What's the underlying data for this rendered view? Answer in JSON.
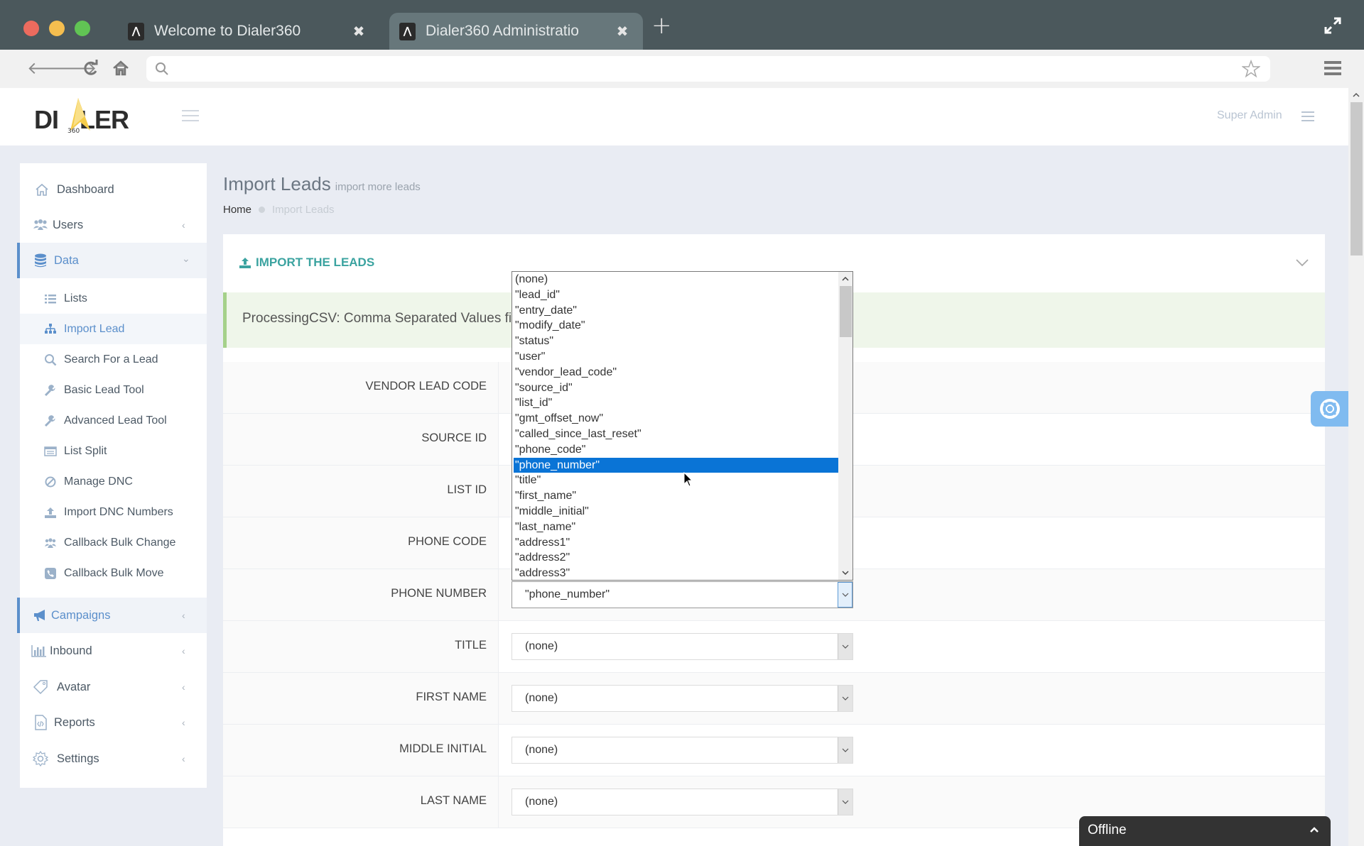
{
  "browser": {
    "tabs": [
      {
        "title": "Welcome to Dialer360",
        "active": false
      },
      {
        "title": "Dialer360 Administratio",
        "active": true
      }
    ],
    "url": "",
    "new_tab_label": "+"
  },
  "header": {
    "logo_text_left": "DI",
    "logo_text_right": "LER",
    "logo_sub": "360",
    "user_name": "Super Admin"
  },
  "sidebar": {
    "items": [
      {
        "label": "Dashboard",
        "icon": "home-icon",
        "active": false,
        "has_chevron": false
      },
      {
        "label": "Users",
        "icon": "users-icon",
        "active": false,
        "has_chevron": true,
        "chevron": "left"
      },
      {
        "label": "Data",
        "icon": "database-icon",
        "active": true,
        "has_chevron": true,
        "chevron": "down"
      },
      {
        "label": "Campaigns",
        "icon": "bullhorn-icon",
        "active": true,
        "has_chevron": true,
        "chevron": "left"
      },
      {
        "label": "Inbound",
        "icon": "bar-chart-icon",
        "active": false,
        "has_chevron": true,
        "chevron": "left"
      },
      {
        "label": "Avatar",
        "icon": "tag-icon",
        "active": false,
        "has_chevron": true,
        "chevron": "left"
      },
      {
        "label": "Reports",
        "icon": "file-code-icon",
        "active": false,
        "has_chevron": true,
        "chevron": "left"
      },
      {
        "label": "Settings",
        "icon": "gear-icon",
        "active": false,
        "has_chevron": true,
        "chevron": "left"
      }
    ],
    "data_submenu": [
      {
        "label": "Lists",
        "icon": "list-icon",
        "active": false
      },
      {
        "label": "Import Lead",
        "icon": "sitemap-icon",
        "active": true
      },
      {
        "label": "Search For a Lead",
        "icon": "search-icon",
        "active": false
      },
      {
        "label": "Basic Lead Tool",
        "icon": "wrench-icon",
        "active": false
      },
      {
        "label": "Advanced Lead Tool",
        "icon": "wrench-icon",
        "active": false
      },
      {
        "label": "List Split",
        "icon": "list-alt-icon",
        "active": false
      },
      {
        "label": "Manage DNC",
        "icon": "ban-icon",
        "active": false
      },
      {
        "label": "Import DNC Numbers",
        "icon": "upload-icon",
        "active": false
      },
      {
        "label": "Callback Bulk Change",
        "icon": "users-icon",
        "active": false
      },
      {
        "label": "Callback Bulk Move",
        "icon": "phone-square-icon",
        "active": false
      }
    ]
  },
  "page": {
    "title": "Import Leads",
    "subtitle": "import more leads",
    "breadcrumb": {
      "home": "Home",
      "current": "Import Leads"
    }
  },
  "panel": {
    "title": "IMPORT THE LEADS",
    "alert": "ProcessingCSV: Comma Separated Values file"
  },
  "form": {
    "rows": [
      {
        "label": "VENDOR LEAD CODE",
        "value": null
      },
      {
        "label": "SOURCE ID",
        "value": null
      },
      {
        "label": "LIST ID",
        "value": null
      },
      {
        "label": "PHONE CODE",
        "value": null
      },
      {
        "label": "PHONE NUMBER",
        "value": "\"phone_number\""
      },
      {
        "label": "TITLE",
        "value": "(none)"
      },
      {
        "label": "FIRST NAME",
        "value": "(none)"
      },
      {
        "label": "MIDDLE INITIAL",
        "value": "(none)"
      },
      {
        "label": "LAST NAME",
        "value": "(none)"
      }
    ]
  },
  "dropdown": {
    "options": [
      "(none)",
      "\"lead_id\"",
      "\"entry_date\"",
      "\"modify_date\"",
      "\"status\"",
      "\"user\"",
      "\"vendor_lead_code\"",
      "\"source_id\"",
      "\"list_id\"",
      "\"gmt_offset_now\"",
      "\"called_since_last_reset\"",
      "\"phone_code\"",
      "\"phone_number\"",
      "\"title\"",
      "\"first_name\"",
      "\"middle_initial\"",
      "\"last_name\"",
      "\"address1\"",
      "\"address2\"",
      "\"address3\""
    ],
    "selected": "\"phone_number\""
  },
  "chat": {
    "status": "Offline"
  },
  "colors": {
    "accent": "#5b8fcb",
    "panel_title": "#3ba3a0",
    "selection": "#0a74d6",
    "help_button": "#80bbf0",
    "alert_bg": "#eff6ea",
    "alert_border": "#a5d18a"
  }
}
